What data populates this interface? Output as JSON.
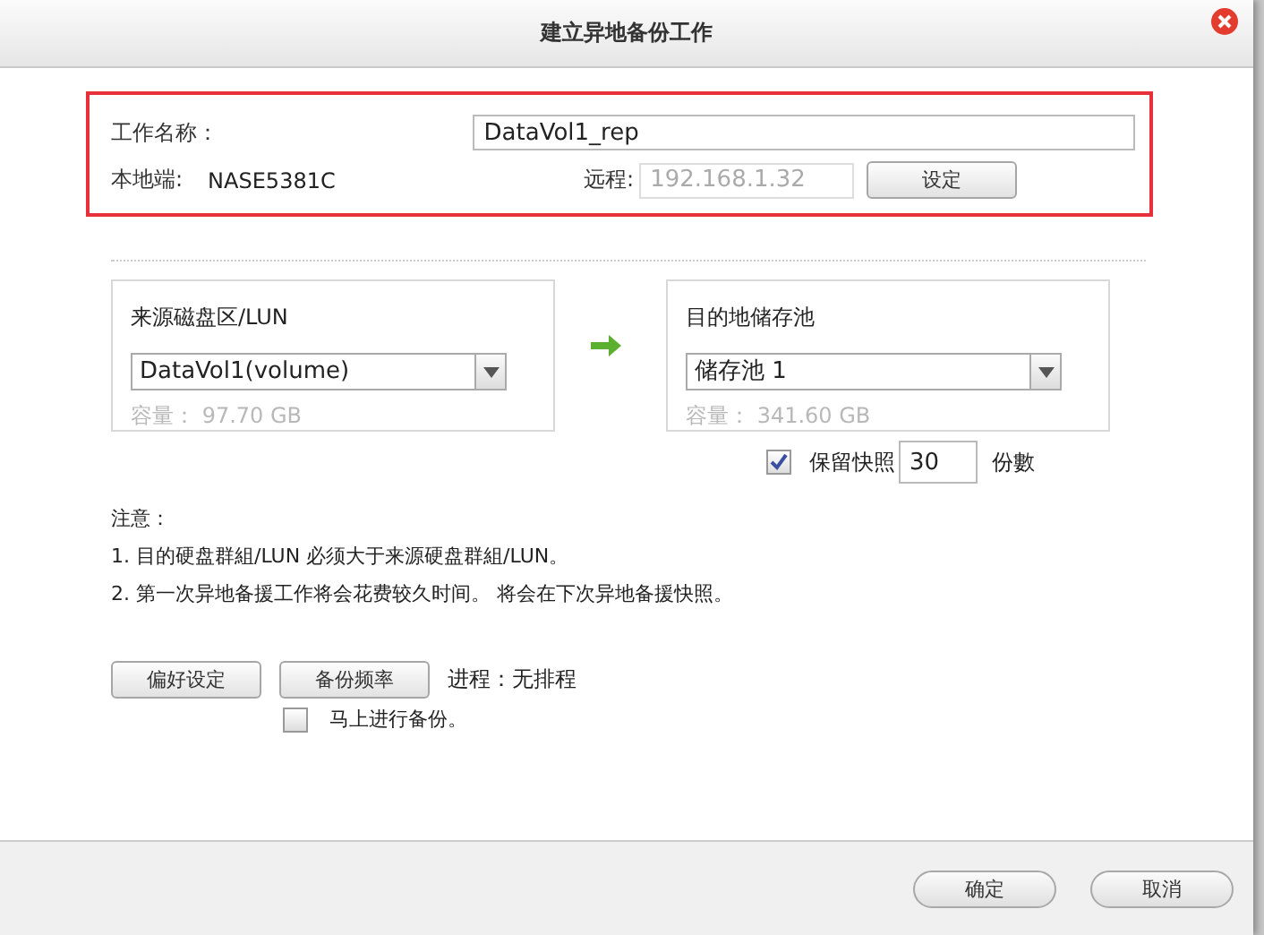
{
  "window": {
    "title": "建立异地备份工作"
  },
  "job": {
    "name_label": "工作名称：",
    "name_value": "DataVol1_rep",
    "local_label": "本地端:",
    "local_value": "NASE5381C",
    "remote_label": "远程:",
    "remote_value": "192.168.1.32",
    "remote_disabled": true,
    "set_button": "设定"
  },
  "source": {
    "title": "来源磁盘区/LUN",
    "selected_value": "DataVol1(volume)",
    "capacity": "容量： 97.70 GB"
  },
  "destination": {
    "title": "目的地储存池",
    "selected_value": "储存池 1",
    "capacity": "容量： 341.60 GB"
  },
  "snapshot": {
    "checked": true,
    "label": "保留快照",
    "count": "30",
    "unit": "份數"
  },
  "notes": {
    "title": "注意：",
    "items": [
      "1. 目的硬盘群組/LUN 必须大于来源硬盘群組/LUN。",
      "2. 第一次异地备援工作将会花费较久时间。 将会在下次异地备援快照。"
    ]
  },
  "actions": {
    "buttons": [
      "偏好设定",
      "备份频率"
    ],
    "schedule": "进程：无排程",
    "backup_now": {
      "checked": false,
      "label": "马上进行备份。"
    }
  },
  "footer": {
    "buttons": [
      "确定",
      "取消"
    ]
  }
}
